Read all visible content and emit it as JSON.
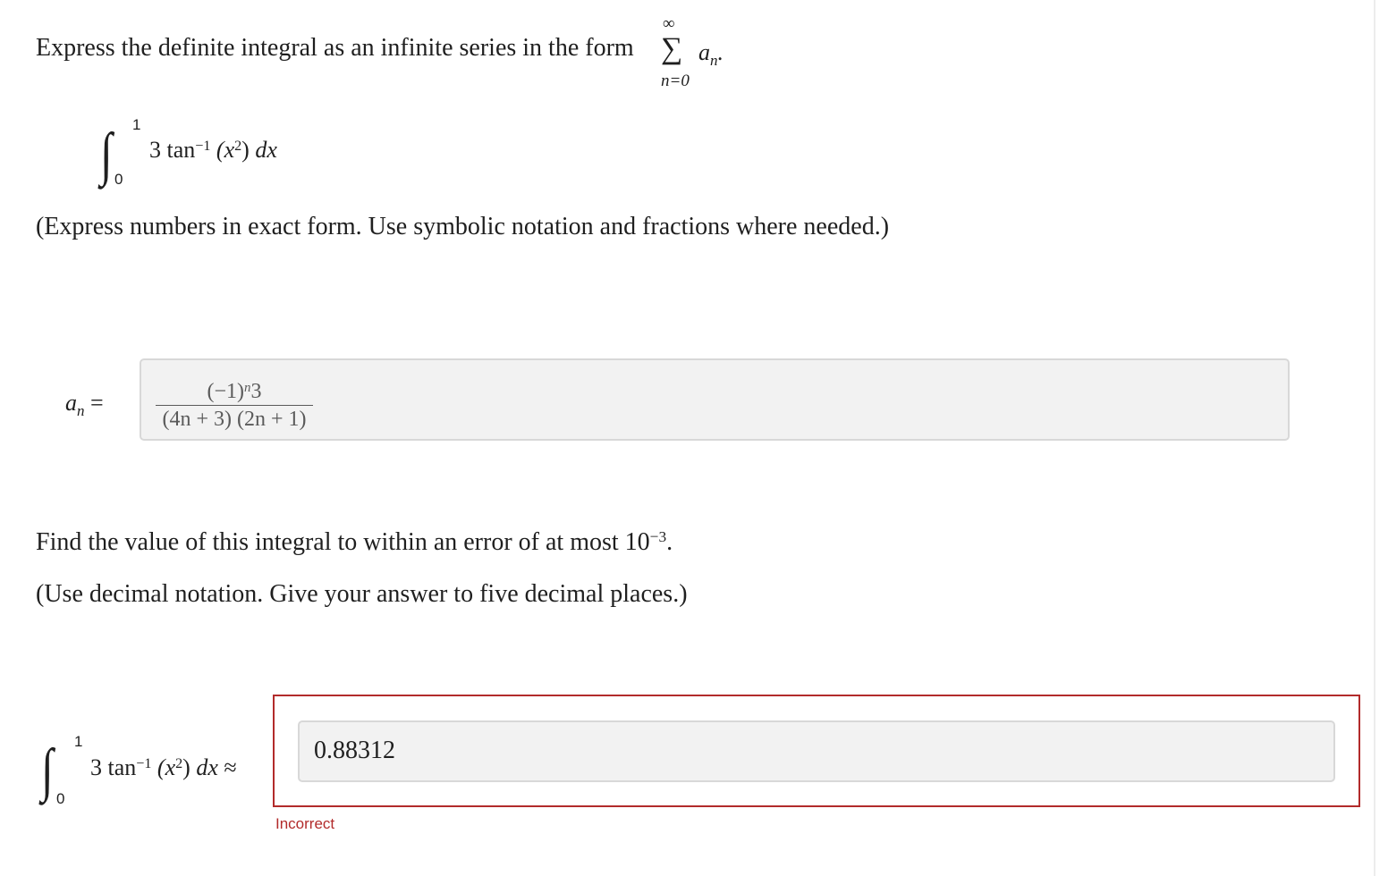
{
  "question": {
    "prompt": "Express the definite integral as an infinite series in the form",
    "series_upper": "∞",
    "series_sigma": "∑",
    "series_lower": "n=0",
    "series_term": "a",
    "series_term_sub": "n",
    "series_period": "."
  },
  "integral": {
    "upper": "1",
    "lower": "0",
    "sign": "∫",
    "coef_fn": "3 tan",
    "fn_sup": "−1",
    "arg_open": " (x",
    "arg_sup": "2",
    "arg_close": ")",
    "dx": " dx"
  },
  "instruction1": "(Express numbers in exact form. Use symbolic notation and fractions where needed.)",
  "an_field": {
    "label_a": "a",
    "label_sub": "n",
    "label_eq": " =",
    "num_pre": "(−1)",
    "num_sup": "n",
    "num_post": "3",
    "denominator": "(4n + 3) (2n + 1)"
  },
  "question2": {
    "prompt": "Find the value of this integral to within an error of at most 10",
    "exp": "−3",
    "period": "."
  },
  "instruction2": "(Use decimal notation. Give your answer to five decimal places.)",
  "value_field": {
    "approx": " ≈",
    "value": "0.88312",
    "feedback": "Incorrect"
  },
  "colors": {
    "error": "#b22b2b",
    "input_bg": "#f2f2f2",
    "input_border": "#d8d8d8"
  }
}
